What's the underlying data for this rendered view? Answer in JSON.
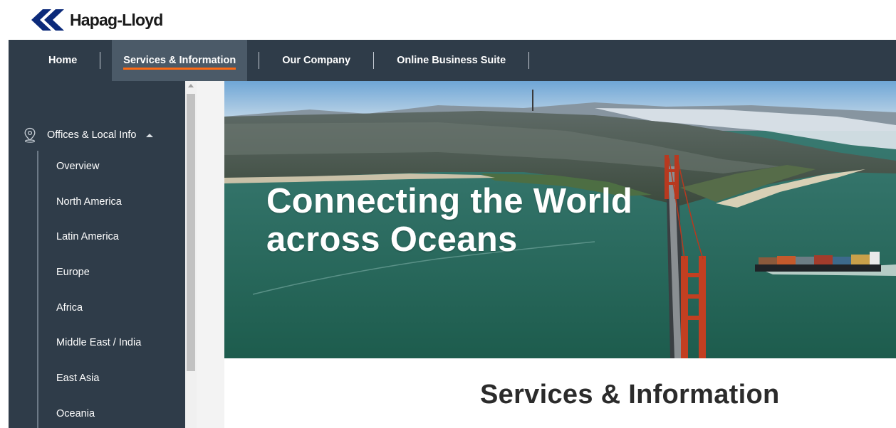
{
  "brand": {
    "name": "Hapag-Lloyd",
    "logo_color": "#0c2a7a"
  },
  "nav": {
    "items": [
      {
        "label": "Home"
      },
      {
        "label": "Services & Information"
      },
      {
        "label": "Our Company"
      },
      {
        "label": "Online Business Suite"
      }
    ],
    "active_index": 1,
    "accent_color": "#ff6a13"
  },
  "sidebar": {
    "section": {
      "label": "Offices & Local Info",
      "icon": "location-pin-icon",
      "expanded": true
    },
    "items": [
      {
        "label": "Overview"
      },
      {
        "label": "North America"
      },
      {
        "label": "Latin America"
      },
      {
        "label": "Europe"
      },
      {
        "label": "Africa"
      },
      {
        "label": "Middle East / India"
      },
      {
        "label": "East Asia"
      },
      {
        "label": "Oceania"
      }
    ]
  },
  "hero": {
    "title_line1": "Connecting the World",
    "title_line2": "across Oceans"
  },
  "main": {
    "title": "Services & Information"
  }
}
